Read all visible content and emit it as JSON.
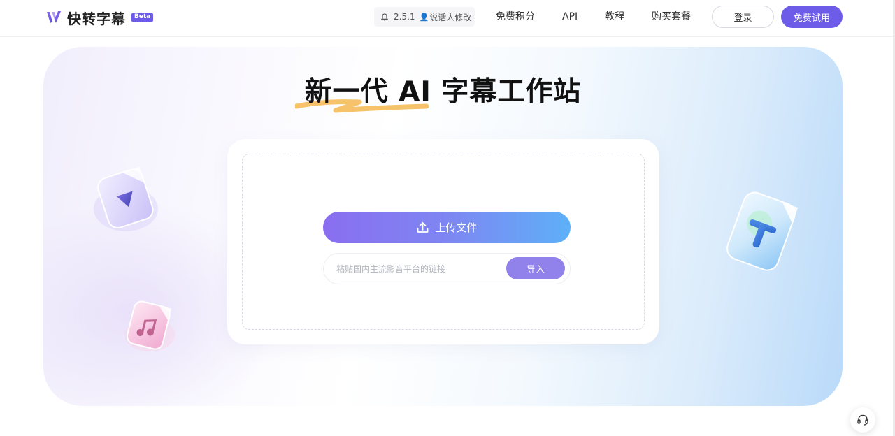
{
  "header": {
    "brand": "快转字幕",
    "badge": "Beta",
    "version": "2.5.1",
    "speaker_edit": "说话人修改",
    "nav": [
      "免费积分",
      "API",
      "教程",
      "购买套餐"
    ],
    "login": "登录",
    "trial": "免费试用"
  },
  "hero": {
    "title": "新一代 AI 字幕工作站",
    "upload_label": "上传文件",
    "link_placeholder": "粘贴国内主流影音平台的链接",
    "import_label": "导入"
  },
  "colors": {
    "brand": "#6c5ce7",
    "upload_start": "#8a6ef0",
    "upload_end": "#5eb0f8",
    "import": "#9181ea",
    "highlight": "#f6c26a"
  },
  "icons": [
    "logo-icon",
    "bell-icon",
    "person-icon",
    "upload-icon",
    "video-file-icon",
    "music-file-icon",
    "text-file-icon",
    "headset-icon"
  ]
}
